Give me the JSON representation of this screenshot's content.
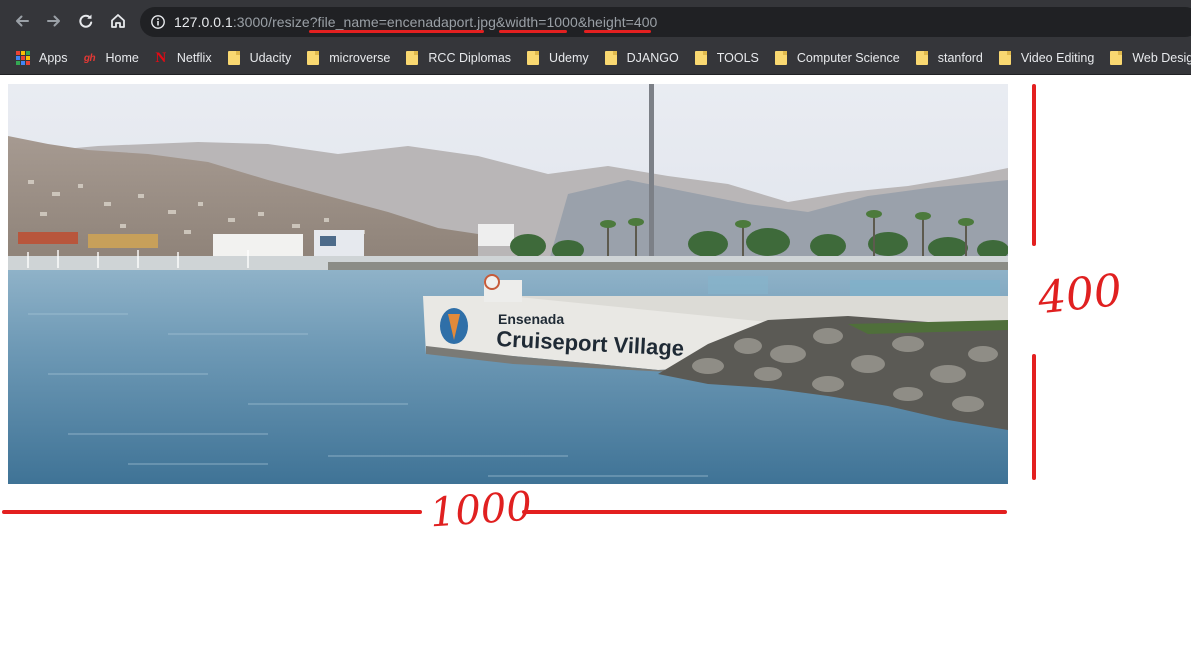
{
  "browser": {
    "url_host": "127.0.0.1",
    "url_path": ":3000/resize?file_name=encenadaport.jpg&width=1000&height=400"
  },
  "bookmarks": [
    {
      "label": "Apps",
      "icon": "apps-grid-icon"
    },
    {
      "label": "Home",
      "icon": "github-icon"
    },
    {
      "label": "Netflix",
      "icon": "netflix-icon"
    },
    {
      "label": "Udacity",
      "icon": "folder-icon"
    },
    {
      "label": "microverse",
      "icon": "folder-icon"
    },
    {
      "label": "RCC Diplomas",
      "icon": "folder-icon"
    },
    {
      "label": "Udemy",
      "icon": "folder-icon"
    },
    {
      "label": "DJANGO",
      "icon": "folder-icon"
    },
    {
      "label": "TOOLS",
      "icon": "folder-icon"
    },
    {
      "label": "Computer Science",
      "icon": "folder-icon"
    },
    {
      "label": "stanford",
      "icon": "folder-icon"
    },
    {
      "label": "Video Editing",
      "icon": "folder-icon"
    },
    {
      "label": "Web Design",
      "icon": "folder-icon"
    }
  ],
  "image": {
    "sign_top": "Ensenada",
    "sign_main": "Cruiseport Village"
  },
  "annotations": {
    "height_label": "400",
    "width_label": "1000",
    "color": "#e32020"
  },
  "colors": {
    "toolbar": "#35363a",
    "omnibox": "#202124"
  }
}
